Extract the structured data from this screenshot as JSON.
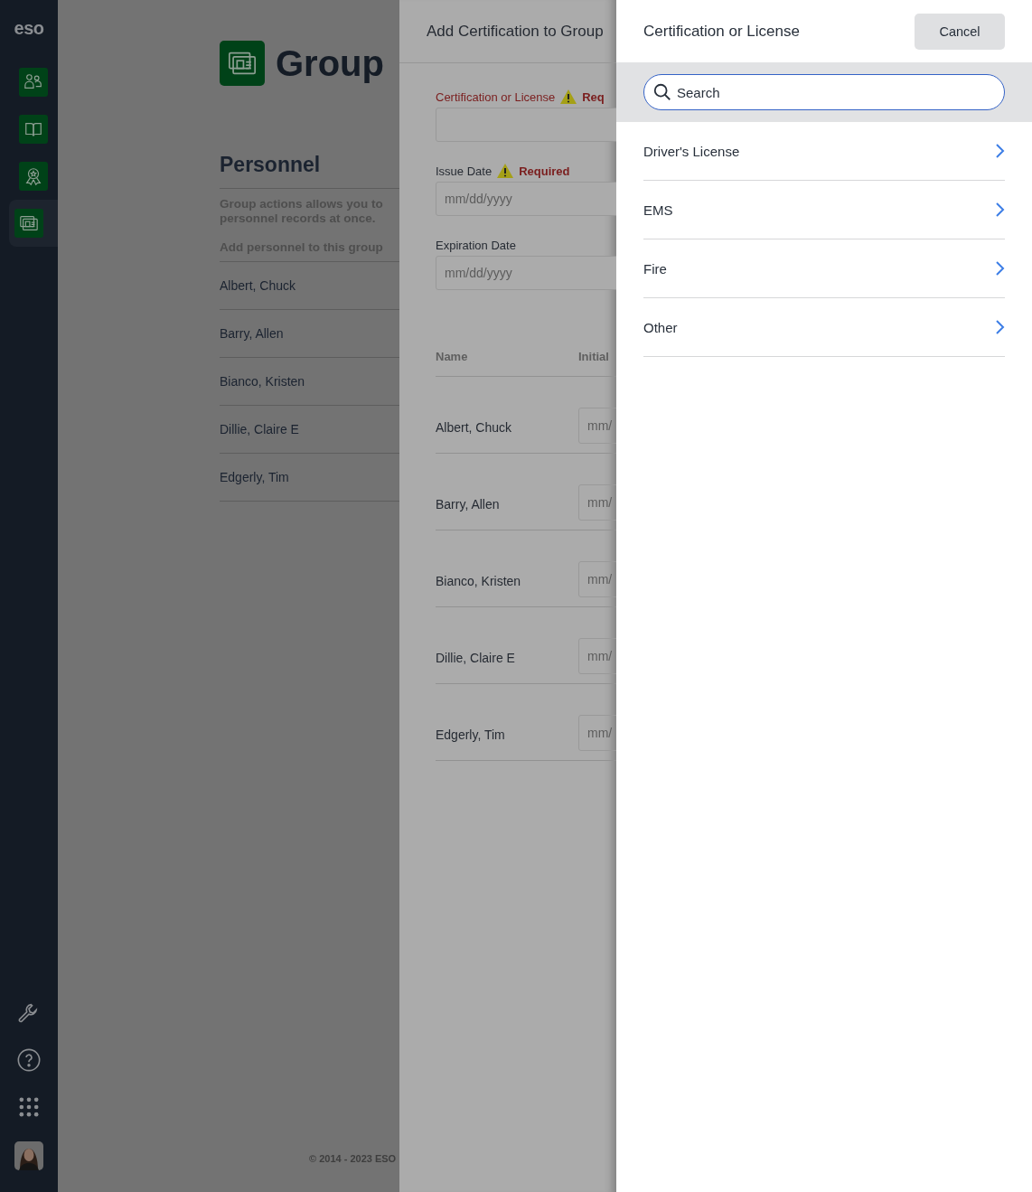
{
  "sidebar": {
    "logo": "eso",
    "nav_items": [
      {
        "kind": "people",
        "selected": false
      },
      {
        "kind": "book",
        "selected": false
      },
      {
        "kind": "award",
        "selected": false
      },
      {
        "kind": "group",
        "selected": true
      }
    ],
    "bottom_items": [
      {
        "kind": "wrench"
      },
      {
        "kind": "help"
      },
      {
        "kind": "apps"
      }
    ]
  },
  "page": {
    "title": "Group",
    "section": "Personnel",
    "description": [
      "Group actions allows you to",
      "personnel records at once."
    ],
    "hint": "Add personnel to this group",
    "personnel": [
      "Albert, Chuck",
      "Barry, Allen",
      "Bianco, Kristen",
      "Dillie, Claire E",
      "Edgerly, Tim"
    ],
    "footer": "© 2014 - 2023 ESO"
  },
  "add_panel": {
    "title": "Add Certification to Group",
    "fields": [
      {
        "label": "Certification or License",
        "required": true,
        "required_text": "Req",
        "error": true
      },
      {
        "label": "Issue Date",
        "required": true,
        "required_text": "Required",
        "error": false,
        "placeholder": "mm/dd/yyyy"
      },
      {
        "label": "Expiration Date",
        "required": false,
        "error": false,
        "placeholder": "mm/dd/yyyy"
      }
    ],
    "columns": [
      "Name",
      "Initial"
    ],
    "rows": [
      {
        "name": "Albert, Chuck",
        "placeholder": "mm/"
      },
      {
        "name": "Barry, Allen",
        "placeholder": "mm/"
      },
      {
        "name": "Bianco, Kristen",
        "placeholder": "mm/"
      },
      {
        "name": "Dillie, Claire E",
        "placeholder": "mm/"
      },
      {
        "name": "Edgerly, Tim",
        "placeholder": "mm/"
      }
    ]
  },
  "picker": {
    "title": "Certification or License",
    "cancel": "Cancel",
    "search": {
      "placeholder": "Search"
    },
    "items": [
      "Driver's License",
      "EMS",
      "Fire",
      "Other"
    ]
  }
}
